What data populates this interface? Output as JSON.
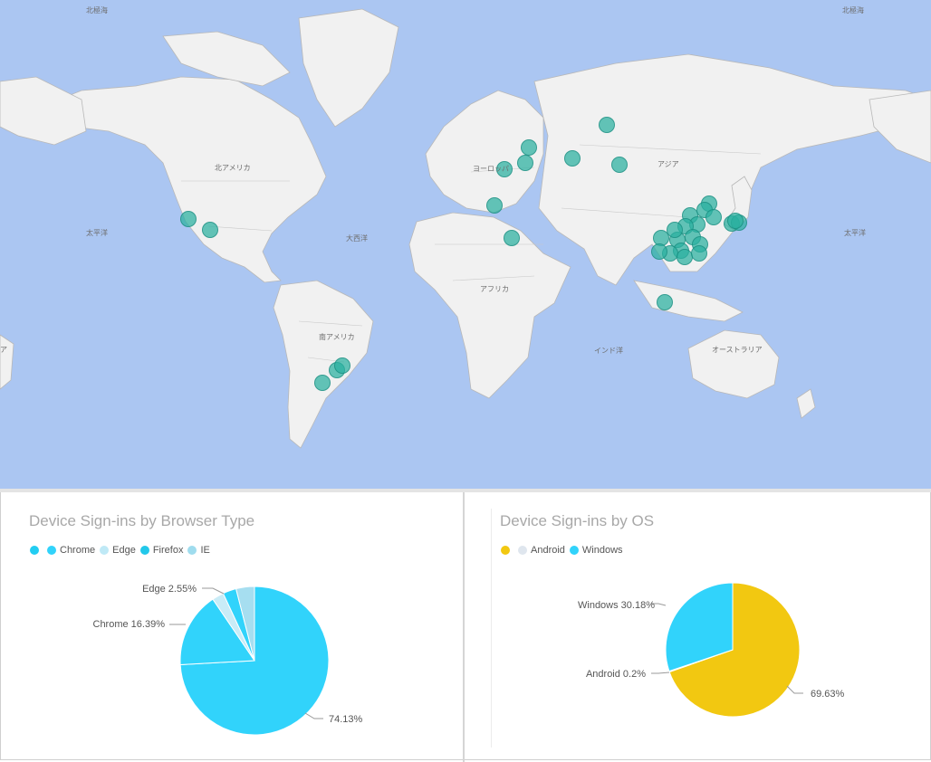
{
  "map": {
    "labels": {
      "arctic_left": "北極海",
      "arctic_right": "北極海",
      "north_america": "北アメリカ",
      "pacific_left": "太平洋",
      "pacific_right": "太平洋",
      "atlantic": "大西洋",
      "south_america": "南アメリカ",
      "africa": "アフリカ",
      "asia": "アジア",
      "europe": "ヨーロッパ",
      "indian_ocean": "インド洋",
      "oceania": "オーストラリア",
      "edge_left": "ア"
    },
    "colors": {
      "ocean": "#abc6f2",
      "land": "#f1f1f1",
      "border": "#b8b8b8",
      "bubble": "#2ab0a0"
    }
  },
  "browser_panel": {
    "title": "Device Sign-ins by Browser Type",
    "legend": [
      {
        "label": "Chrome",
        "color": "#31d3fb"
      },
      {
        "label": "Edge",
        "color": "#bfe9f6"
      },
      {
        "label": "Firefox",
        "color": "#22c8ea"
      },
      {
        "label": "IE",
        "color": "#9fdcee"
      }
    ],
    "legend_lead_color": "#22cdf2",
    "chart_data": {
      "type": "pie",
      "title": "Device Sign-ins by Browser Type",
      "slices": [
        {
          "name": "Chrome",
          "value": 16.39,
          "label": "Chrome 16.39%",
          "color": "#31d3fb"
        },
        {
          "name": "Edge",
          "value": 2.55,
          "label": "Edge 2.55%",
          "color": "#c9ecf7"
        },
        {
          "name": "Firefox",
          "value": 2.93,
          "label": "",
          "color": "#31d3fb"
        },
        {
          "name": "IE",
          "value": 4.0,
          "label": "",
          "color": "#a6def0"
        },
        {
          "name": "",
          "value": 74.13,
          "label": "74.13%",
          "color": "#31d3fb"
        }
      ]
    }
  },
  "os_panel": {
    "title": "Device Sign-ins by OS",
    "legend": [
      {
        "label": "Android",
        "color": "#dfe6ee"
      },
      {
        "label": "Windows",
        "color": "#31d3fb"
      }
    ],
    "legend_lead_color": "#f2c811",
    "chart_data": {
      "type": "pie",
      "title": "Device Sign-ins by OS",
      "slices": [
        {
          "name": "",
          "value": 69.63,
          "label": "69.63%",
          "color": "#f2c811"
        },
        {
          "name": "Android",
          "value": 0.2,
          "label": "Android 0.2%",
          "color": "#dfe6ee"
        },
        {
          "name": "Windows",
          "value": 30.18,
          "label": "Windows 30.18%",
          "color": "#31d3fb"
        }
      ]
    }
  }
}
